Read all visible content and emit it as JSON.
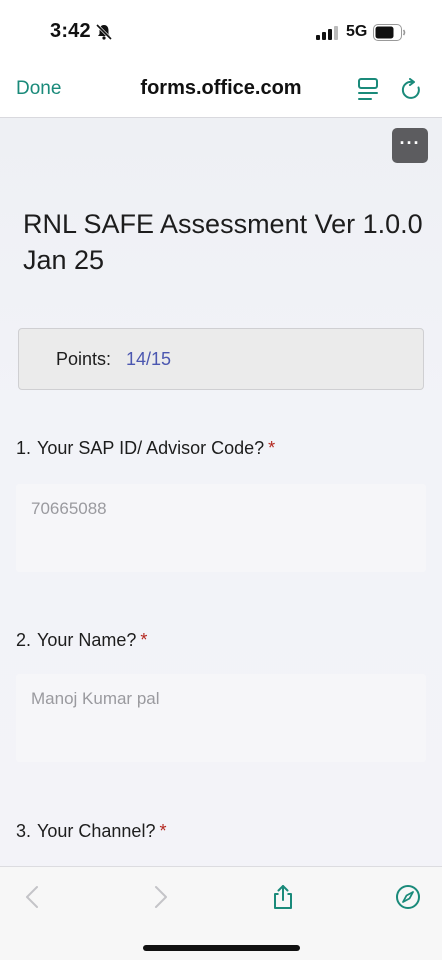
{
  "status_bar": {
    "time": "3:42",
    "network": "5G"
  },
  "nav": {
    "done_label": "Done",
    "url": "forms.office.com"
  },
  "form": {
    "more_label": "···",
    "title": "RNL SAFE Assessment Ver 1.0.0 Jan 25",
    "points_label": "Points:",
    "points_value": "14/15",
    "questions": [
      {
        "number": "1.",
        "text": "Your SAP ID/ Advisor Code?",
        "required_mark": "*",
        "answer": "70665088"
      },
      {
        "number": "2.",
        "text": "Your Name?",
        "required_mark": "*",
        "answer": "Manoj Kumar pal"
      },
      {
        "number": "3.",
        "text": "Your Channel?",
        "required_mark": "*"
      }
    ]
  },
  "colors": {
    "accent": "#1a8a7a",
    "points_value": "#4b57b0",
    "required": "#b3261e"
  },
  "toolbar": {
    "icons": [
      "back-icon",
      "forward-icon",
      "share-icon",
      "compass-icon"
    ]
  }
}
